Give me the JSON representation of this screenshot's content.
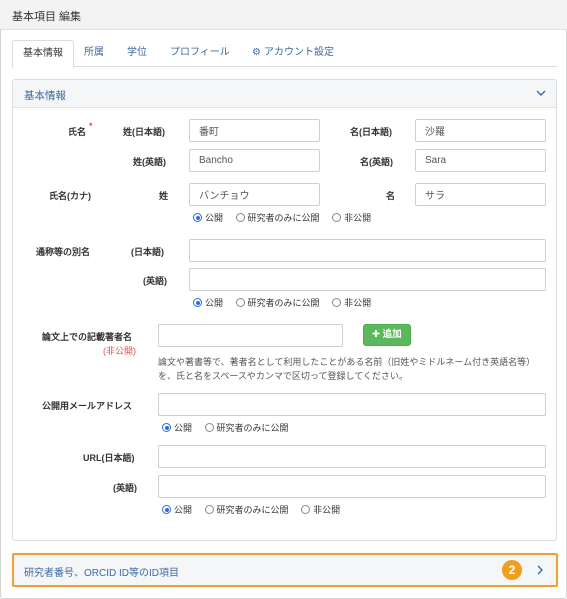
{
  "window": {
    "title": "基本項目 編集"
  },
  "tabs": [
    {
      "label": "基本情報"
    },
    {
      "label": "所属"
    },
    {
      "label": "学位"
    },
    {
      "label": "プロフィール"
    },
    {
      "label": "アカウント設定",
      "icon": "gear-icon"
    }
  ],
  "basic_panel": {
    "title": "基本情報",
    "name": {
      "label": "氏名",
      "required_mark": "*",
      "family_ja_label": "姓(日本語)",
      "family_ja_value": "番町",
      "given_ja_label": "名(日本語)",
      "given_ja_value": "沙羅",
      "family_en_label": "姓(英語)",
      "family_en_value": "Bancho",
      "given_en_label": "名(英語)",
      "given_en_value": "Sara"
    },
    "kana": {
      "label": "氏名(カナ)",
      "family_label": "姓",
      "family_value": "バンチョウ",
      "given_label": "名",
      "given_value": "サラ"
    },
    "visibility_options": [
      "公開",
      "研究者のみに公開",
      "非公開"
    ],
    "alias": {
      "label": "通称等の別名",
      "ja_label": "(日本語)",
      "ja_value": "",
      "en_label": "(英語)",
      "en_value": ""
    },
    "paper_author": {
      "label": "論文上での記載著者名",
      "sub_label": "(非公開)",
      "value": "",
      "add_label": "追加",
      "note": "論文や著書等で、著者名として利用したことがある名前（旧姓やミドルネーム付き英語名等）を、氏と名をスペースやカンマで区切って登録してください。"
    },
    "email": {
      "label": "公開用メールアドレス",
      "value": "",
      "visibility_options": [
        "公開",
        "研究者のみに公開"
      ]
    },
    "url": {
      "ja_label": "URL(日本語)",
      "ja_value": "",
      "en_label": "(英語)",
      "en_value": ""
    }
  },
  "id_panel": {
    "title": "研究者番号、ORCID ID等のID項目",
    "badge": "2"
  },
  "colors": {
    "accent": "#3b6aa0",
    "add_button": "#5cb85c",
    "highlight": "#f0a030",
    "badge": "#f29d1c"
  }
}
